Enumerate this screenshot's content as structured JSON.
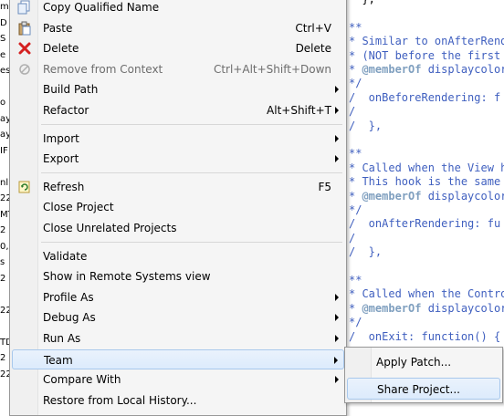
{
  "left_tree": [
    "m",
    "D",
    "S",
    "e",
    "es",
    "",
    "o",
    "ay",
    "ay",
    "IF",
    "",
    "nl",
    "22",
    "MT",
    "2",
    "0,",
    "s",
    "2",
    "",
    "22",
    "",
    "TD",
    "2",
    "22"
  ],
  "editor_lines": [
    {
      "parts": [
        {
          "t": "  },",
          "c": "tx"
        }
      ]
    },
    {
      "parts": []
    },
    {
      "parts": [
        {
          "t": "**",
          "c": "cm"
        }
      ]
    },
    {
      "parts": [
        {
          "t": "* Similar to onAfterRend",
          "c": "cm"
        }
      ]
    },
    {
      "parts": [
        {
          "t": "* (NOT before the first",
          "c": "cm"
        }
      ]
    },
    {
      "parts": [
        {
          "t": "* ",
          "c": "cm"
        },
        {
          "t": "@memberOf",
          "c": "tag"
        },
        {
          "t": " displaycolor",
          "c": "cm"
        }
      ]
    },
    {
      "parts": [
        {
          "t": "*/",
          "c": "cm"
        }
      ]
    },
    {
      "parts": [
        {
          "t": "/  onBeforeRendering: f",
          "c": "cm"
        }
      ]
    },
    {
      "parts": [
        {
          "t": "/",
          "c": "cm"
        }
      ]
    },
    {
      "parts": [
        {
          "t": "/  },",
          "c": "cm"
        }
      ]
    },
    {
      "parts": []
    },
    {
      "parts": [
        {
          "t": "**",
          "c": "cm"
        }
      ]
    },
    {
      "parts": [
        {
          "t": "* Called when the View h",
          "c": "cm"
        }
      ]
    },
    {
      "parts": [
        {
          "t": "* This hook is the same",
          "c": "cm"
        }
      ]
    },
    {
      "parts": [
        {
          "t": "* ",
          "c": "cm"
        },
        {
          "t": "@memberOf",
          "c": "tag"
        },
        {
          "t": " displaycolor",
          "c": "cm"
        }
      ]
    },
    {
      "parts": [
        {
          "t": "*/",
          "c": "cm"
        }
      ]
    },
    {
      "parts": [
        {
          "t": "/  onAfterRendering: fu",
          "c": "cm"
        }
      ]
    },
    {
      "parts": [
        {
          "t": "/",
          "c": "cm"
        }
      ]
    },
    {
      "parts": [
        {
          "t": "/  },",
          "c": "cm"
        }
      ]
    },
    {
      "parts": []
    },
    {
      "parts": [
        {
          "t": "**",
          "c": "cm"
        }
      ]
    },
    {
      "parts": [
        {
          "t": "* Called when the Contro",
          "c": "cm"
        }
      ]
    },
    {
      "parts": [
        {
          "t": "* ",
          "c": "cm"
        },
        {
          "t": "@memberOf",
          "c": "tag"
        },
        {
          "t": " displaycolor",
          "c": "cm"
        }
      ]
    },
    {
      "parts": [
        {
          "t": "*/",
          "c": "cm"
        }
      ]
    },
    {
      "parts": [
        {
          "t": "/  onExit: function() {",
          "c": "cm"
        }
      ]
    },
    {
      "parts": []
    }
  ],
  "menu": {
    "items": [
      {
        "label": "Copy Qualified Name",
        "accel": "",
        "icon": "copy-icon",
        "submenu": false,
        "disabled": false
      },
      {
        "label": "Paste",
        "accel": "Ctrl+V",
        "icon": "paste-icon",
        "submenu": false,
        "disabled": false
      },
      {
        "label": "Delete",
        "accel": "Delete",
        "icon": "delete-icon",
        "submenu": false,
        "disabled": false
      },
      {
        "label": "Remove from Context",
        "accel": "Ctrl+Alt+Shift+Down",
        "icon": "remove-context-icon",
        "submenu": false,
        "disabled": true
      },
      {
        "label": "Build Path",
        "accel": "",
        "icon": "",
        "submenu": true,
        "disabled": false
      },
      {
        "label": "Refactor",
        "accel": "Alt+Shift+T",
        "icon": "",
        "submenu": true,
        "disabled": false
      },
      {
        "sep": true
      },
      {
        "label": "Import",
        "accel": "",
        "icon": "",
        "submenu": true,
        "disabled": false
      },
      {
        "label": "Export",
        "accel": "",
        "icon": "",
        "submenu": true,
        "disabled": false
      },
      {
        "sep": true
      },
      {
        "label": "Refresh",
        "accel": "F5",
        "icon": "refresh-icon",
        "submenu": false,
        "disabled": false
      },
      {
        "label": "Close Project",
        "accel": "",
        "icon": "",
        "submenu": false,
        "disabled": false
      },
      {
        "label": "Close Unrelated Projects",
        "accel": "",
        "icon": "",
        "submenu": false,
        "disabled": false
      },
      {
        "sep": true
      },
      {
        "label": "Validate",
        "accel": "",
        "icon": "",
        "submenu": false,
        "disabled": false
      },
      {
        "label": "Show in Remote Systems view",
        "accel": "",
        "icon": "",
        "submenu": false,
        "disabled": false
      },
      {
        "label": "Profile As",
        "accel": "",
        "icon": "",
        "submenu": true,
        "disabled": false
      },
      {
        "label": "Debug As",
        "accel": "",
        "icon": "",
        "submenu": true,
        "disabled": false
      },
      {
        "label": "Run As",
        "accel": "",
        "icon": "",
        "submenu": true,
        "disabled": false
      },
      {
        "label": "Team",
        "accel": "",
        "icon": "",
        "submenu": true,
        "disabled": false,
        "highlighted": true
      },
      {
        "label": "Compare With",
        "accel": "",
        "icon": "",
        "submenu": true,
        "disabled": false
      },
      {
        "label": "Restore from Local History...",
        "accel": "",
        "icon": "",
        "submenu": false,
        "disabled": false
      }
    ]
  },
  "submenu": {
    "items": [
      {
        "label": "Apply Patch...",
        "highlighted": false
      },
      {
        "label": "Share Project...",
        "highlighted": true
      }
    ]
  },
  "colors": {
    "highlight": "#dcebfc",
    "highlight_border": "#a8c8ec",
    "comment": "#3f5fbf",
    "doc_tag": "#7f9fbf"
  }
}
